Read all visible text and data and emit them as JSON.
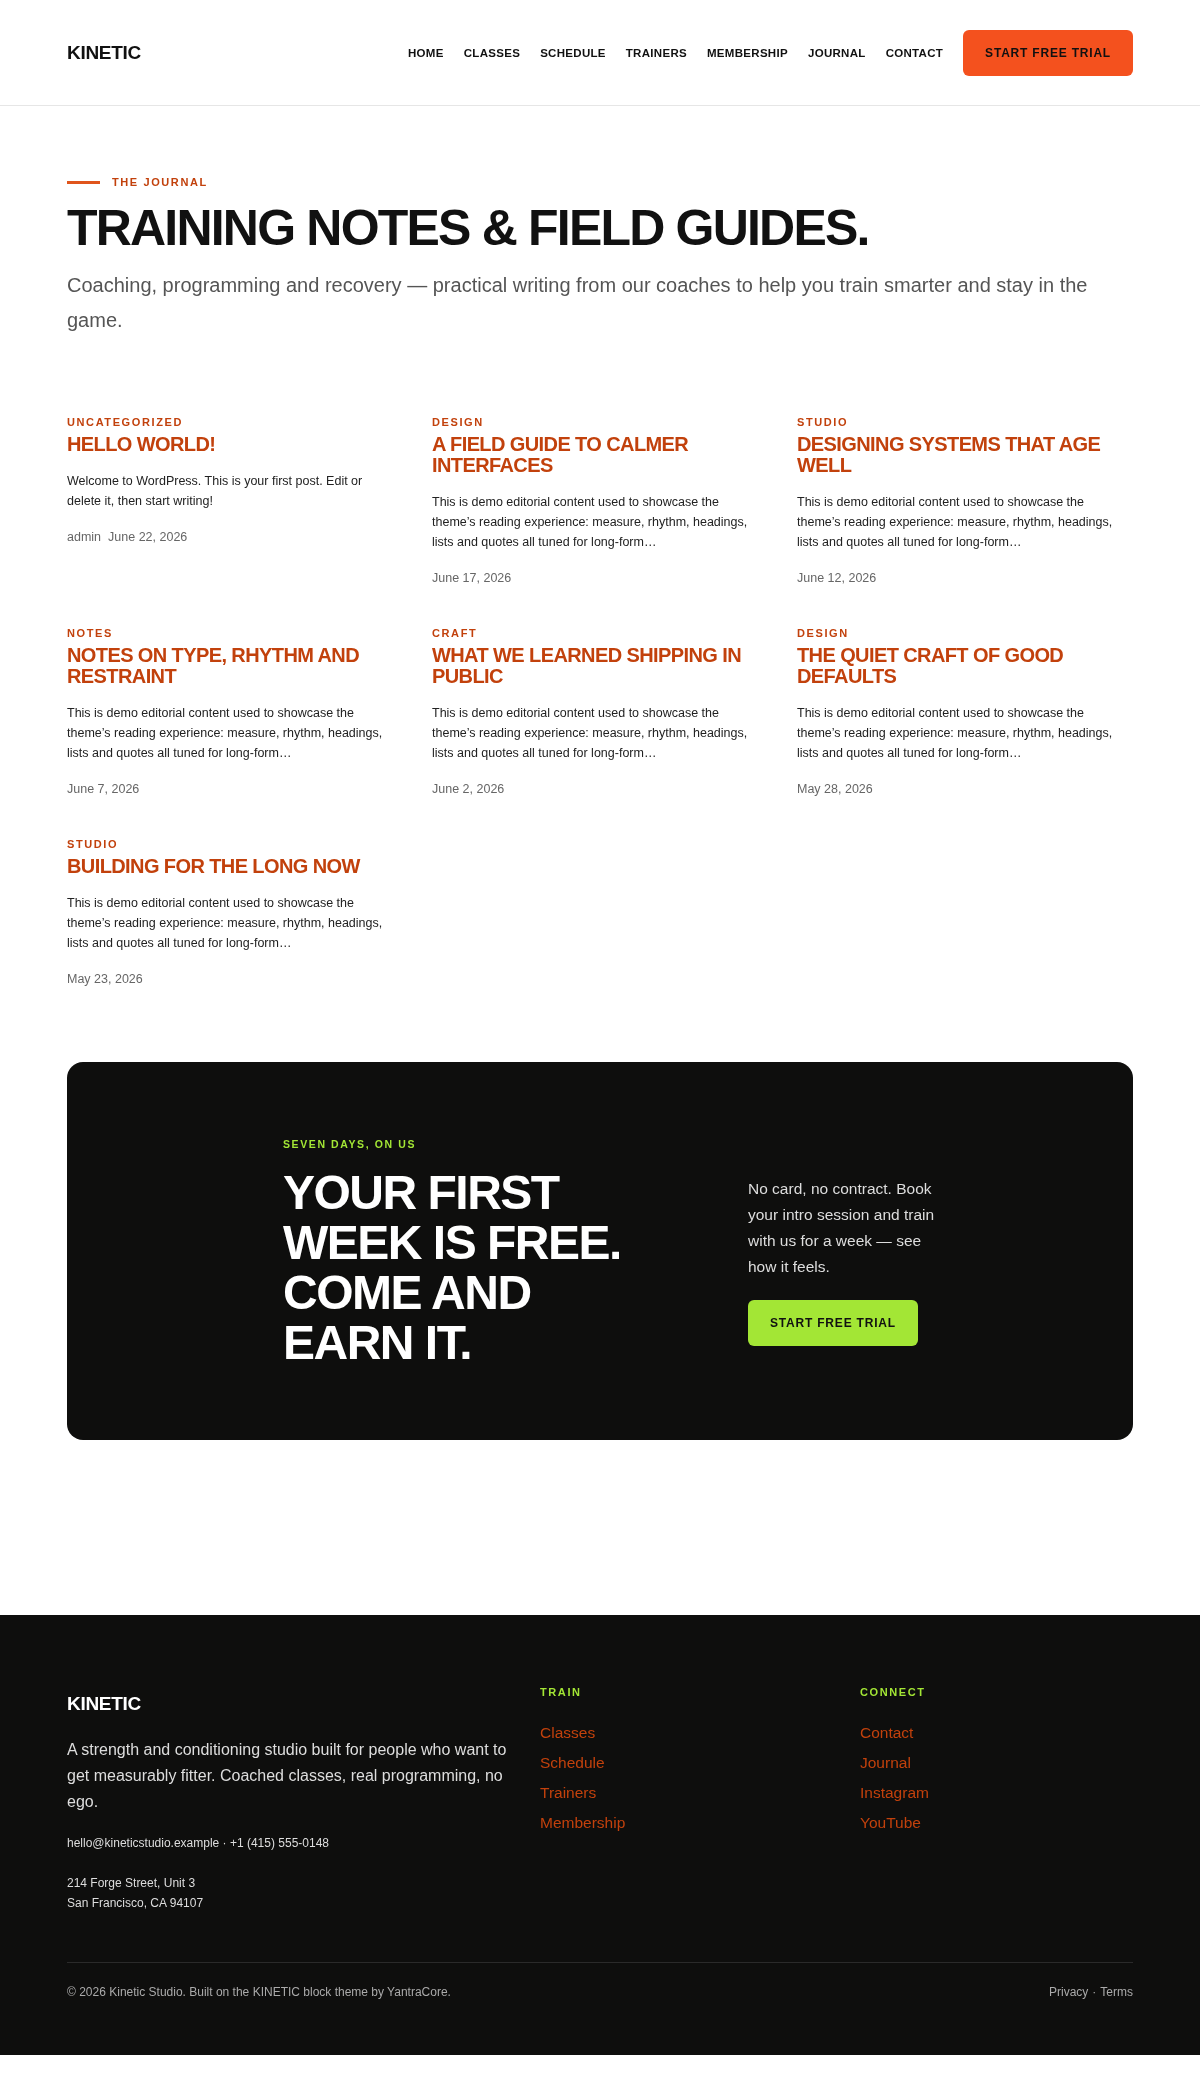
{
  "header": {
    "logo": "KINETIC",
    "nav": [
      {
        "label": "HOME",
        "selected": false
      },
      {
        "label": "CLASSES",
        "selected": false
      },
      {
        "label": "SCHEDULE",
        "selected": false
      },
      {
        "label": "TRAINERS",
        "selected": false
      },
      {
        "label": "MEMBERSHIP",
        "selected": false
      },
      {
        "label": "JOURNAL",
        "selected": false
      },
      {
        "label": "CONTACT",
        "selected": false
      }
    ],
    "cta": "START FREE TRIAL"
  },
  "hero": {
    "eyebrow": "THE JOURNAL",
    "title": "TRAINING NOTES & FIELD GUIDES.",
    "subtitle": "Coaching, programming and recovery — practical writing from our coaches to help you train smarter and stay in the game."
  },
  "posts": [
    {
      "category": "UNCATEGORIZED",
      "title": "HELLO WORLD!",
      "excerpt": "Welcome to WordPress. This is your first post. Edit or delete it, then start writing!",
      "author": "admin",
      "date": "June 22, 2026"
    },
    {
      "category": "DESIGN",
      "title": "A FIELD GUIDE TO CALMER INTERFACES",
      "excerpt": "This is demo editorial content used to showcase the theme’s reading experience: measure, rhythm, headings, lists and quotes all tuned for long-form…",
      "date": "June 17, 2026"
    },
    {
      "category": "STUDIO",
      "title": "DESIGNING SYSTEMS THAT AGE WELL",
      "excerpt": "This is demo editorial content used to showcase the theme’s reading experience: measure, rhythm, headings, lists and quotes all tuned for long-form…",
      "date": "June 12, 2026"
    },
    {
      "category": "NOTES",
      "title": "NOTES ON TYPE, RHYTHM AND RESTRAINT",
      "excerpt": "This is demo editorial content used to showcase the theme’s reading experience: measure, rhythm, headings, lists and quotes all tuned for long-form…",
      "date": "June 7, 2026"
    },
    {
      "category": "CRAFT",
      "title": "WHAT WE LEARNED SHIPPING IN PUBLIC",
      "excerpt": "This is demo editorial content used to showcase the theme’s reading experience: measure, rhythm, headings, lists and quotes all tuned for long-form…",
      "date": "June 2, 2026"
    },
    {
      "category": "DESIGN",
      "title": "THE QUIET CRAFT OF GOOD DEFAULTS",
      "excerpt": "This is demo editorial content used to showcase the theme’s reading experience: measure, rhythm, headings, lists and quotes all tuned for long-form…",
      "date": "May 28, 2026"
    },
    {
      "category": "STUDIO",
      "title": "BUILDING FOR THE LONG NOW",
      "excerpt": "This is demo editorial content used to showcase the theme’s reading experience: measure, rhythm, headings, lists and quotes all tuned for long-form…",
      "date": "May 23, 2026"
    }
  ],
  "cta_banner": {
    "eyebrow": "SEVEN DAYS, ON US",
    "headline": "YOUR FIRST WEEK IS FREE. COME AND EARN IT.",
    "text": "No card, no contract. Book your intro session and train with us for a week — see how it feels.",
    "button": "START FREE TRIAL"
  },
  "footer": {
    "logo": "KINETIC",
    "about": "A strength and conditioning studio built for people who want to get measurably fitter. Coached classes, real programming, no ego.",
    "contact": "hello@kineticstudio.example · +1 (415) 555-0148",
    "address": [
      "214 Forge Street, Unit 3",
      "San Francisco, CA 94107"
    ],
    "columns": [
      {
        "heading": "TRAIN",
        "links": [
          "Classes",
          "Schedule",
          "Trainers",
          "Membership"
        ]
      },
      {
        "heading": "CONNECT",
        "links": [
          "Contact",
          "Journal",
          "Instagram",
          "YouTube"
        ]
      }
    ],
    "copyright": "© 2026 Kinetic Studio. Built on the KINETIC block theme by YantraCore.",
    "legal_links": [
      "Privacy",
      "Terms"
    ],
    "legal_separator": "·"
  }
}
